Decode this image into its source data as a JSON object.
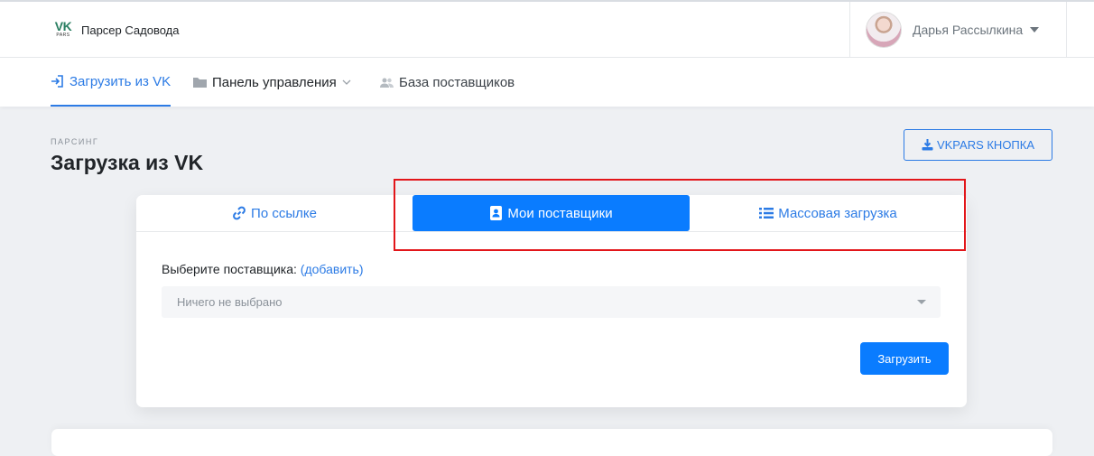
{
  "header": {
    "logo_main": "VK",
    "logo_sub": "PARS",
    "app_name": "Парсер Садовода",
    "user_name": "Дарья Рассылкина"
  },
  "nav": {
    "items": [
      {
        "label": "Загрузить из VK",
        "icon": "sign-in-icon",
        "active": true
      },
      {
        "label": "Панель управления",
        "icon": "folder-icon",
        "dropdown": true
      },
      {
        "label": "База поставщиков",
        "icon": "users-icon"
      }
    ]
  },
  "page": {
    "kicker": "ПАРСИНГ",
    "title": "Загрузка из VK",
    "vkpars_button": "VKPARS КНОПКА"
  },
  "card": {
    "tabs": [
      {
        "label": "По ссылке",
        "icon": "link-icon"
      },
      {
        "label": "Мои поставщики",
        "icon": "address-book-icon",
        "active": true
      },
      {
        "label": "Массовая загрузка",
        "icon": "list-icon"
      }
    ],
    "supplier_label": "Выберите поставщика:",
    "add_link": "(добавить)",
    "select_placeholder": "Ничего не выбрано",
    "submit_label": "Загрузить"
  },
  "colors": {
    "accent": "#2c7be5",
    "primary_button": "#0a7cff",
    "highlight_frame": "#e2161a"
  }
}
